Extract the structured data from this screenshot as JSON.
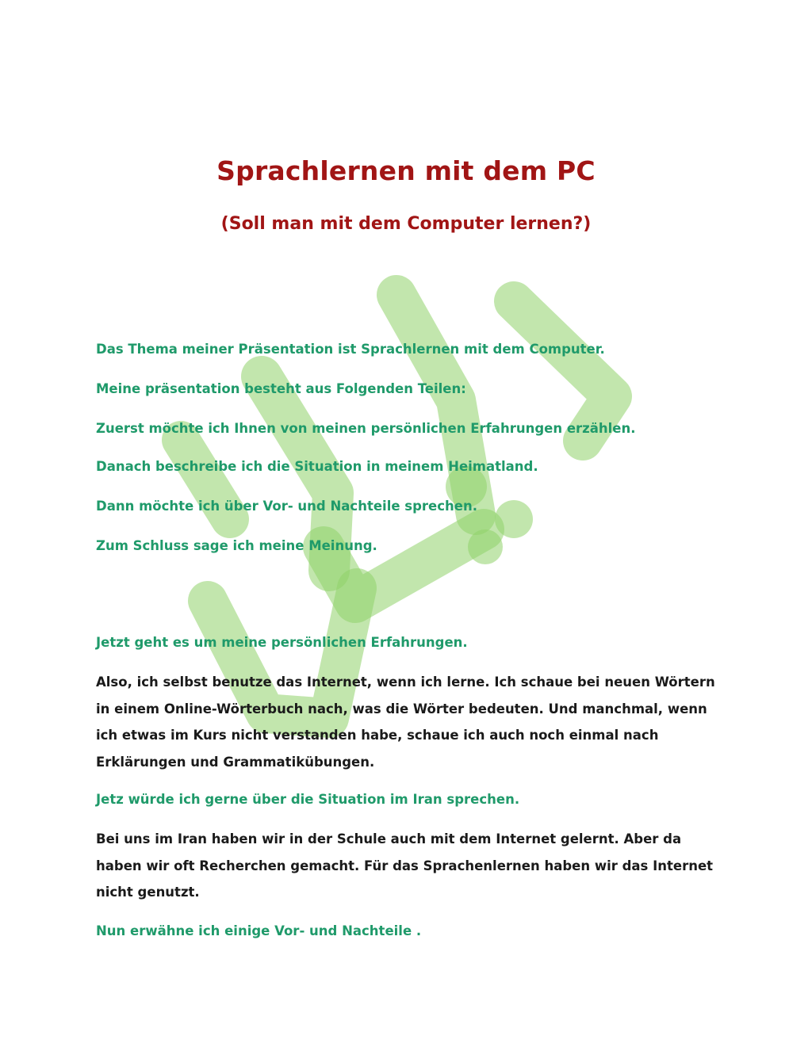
{
  "document": {
    "title": "Sprachlernen mit dem PC",
    "subtitle": "(Soll man mit dem Computer lernen?)",
    "intro_lines": [
      "Das Thema meiner Präsentation ist Sprachlernen mit dem Computer.",
      "Meine präsentation besteht aus Folgenden Teilen:",
      "Zuerst möchte ich Ihnen von meinen persönlichen Erfahrungen erzählen.",
      "Danach beschreibe ich die Situation in meinem Heimatland.",
      "Dann möchte ich über Vor-  und Nachteile sprechen.",
      "Zum Schluss sage ich meine Meinung."
    ],
    "section1_heading": "Jetzt geht es um meine persönlichen Erfahrungen.",
    "section1_body": "Also, ich selbst benutze das Internet, wenn ich lerne. Ich schaue bei neuen Wörtern in einem Online-Wörterbuch nach, was die Wörter bedeuten. Und manchmal, wenn ich etwas im Kurs nicht verstanden habe, schaue ich auch noch einmal nach Erklärungen und Grammatikübungen.",
    "section2_heading": "Jetz würde ich gerne über die Situation im Iran sprechen.",
    "section2_body": "Bei uns im Iran haben wir in der Schule auch mit dem Internet gelernt. Aber da haben wir oft Recherchen gemacht. Für das Sprachenlernen haben wir das Internet nicht genutzt.",
    "section3_heading": "Nun erwähne ich einige Vor- und Nachteile ."
  },
  "colors": {
    "title": "#a11515",
    "heading_green": "#1f9a6a",
    "body_text": "#1a1a1a",
    "watermark": "#b5e08c"
  },
  "watermark": {
    "icon": "arabic-calligraphy-watermark"
  }
}
